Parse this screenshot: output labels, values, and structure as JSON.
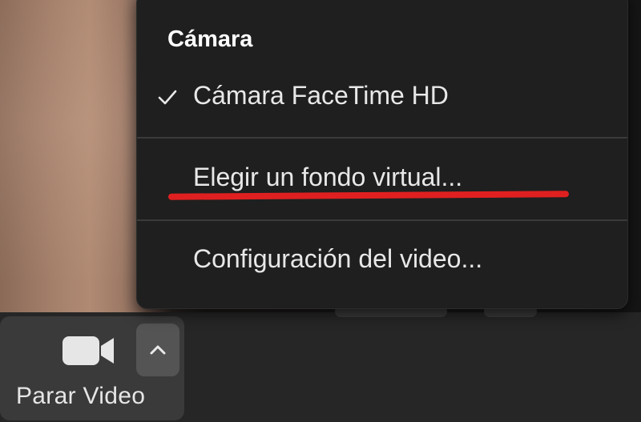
{
  "camera_menu": {
    "header": "Cámara",
    "items": [
      {
        "label": "Cámara FaceTime HD",
        "checked": true
      },
      {
        "label": "Elegir un fondo virtual...",
        "highlighted": true
      },
      {
        "label": "Configuración del video..."
      }
    ]
  },
  "toolbar": {
    "video_button_label": "Parar Video",
    "camera_icon": "video-camera-icon",
    "caret_icon": "chevron-up-icon"
  },
  "colors": {
    "menu_background": "#1f1f1f",
    "toolbar_background": "#262626",
    "annotation_red": "#e02020"
  }
}
